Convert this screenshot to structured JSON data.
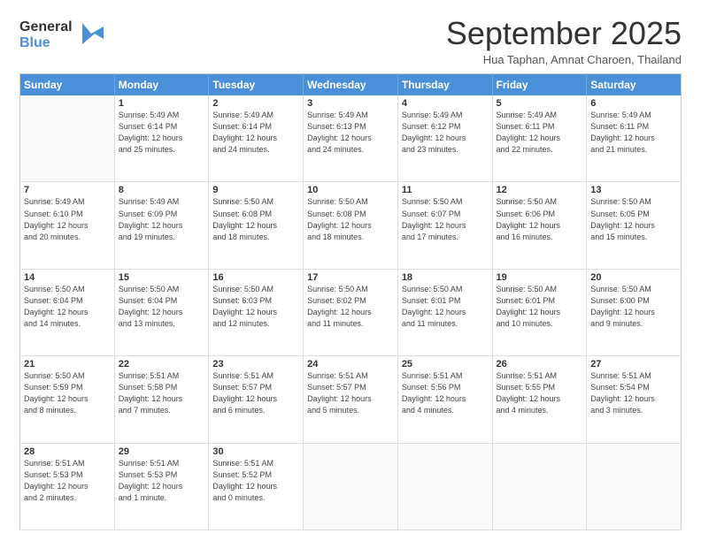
{
  "logo": {
    "line1": "General",
    "line2": "Blue"
  },
  "title": "September 2025",
  "location": "Hua Taphan, Amnat Charoen, Thailand",
  "days_of_week": [
    "Sunday",
    "Monday",
    "Tuesday",
    "Wednesday",
    "Thursday",
    "Friday",
    "Saturday"
  ],
  "weeks": [
    [
      {
        "num": "",
        "empty": true
      },
      {
        "num": "1",
        "rise": "5:49 AM",
        "set": "6:14 PM",
        "daylight": "12 hours and 25 minutes."
      },
      {
        "num": "2",
        "rise": "5:49 AM",
        "set": "6:14 PM",
        "daylight": "12 hours and 24 minutes."
      },
      {
        "num": "3",
        "rise": "5:49 AM",
        "set": "6:13 PM",
        "daylight": "12 hours and 24 minutes."
      },
      {
        "num": "4",
        "rise": "5:49 AM",
        "set": "6:12 PM",
        "daylight": "12 hours and 23 minutes."
      },
      {
        "num": "5",
        "rise": "5:49 AM",
        "set": "6:11 PM",
        "daylight": "12 hours and 22 minutes."
      },
      {
        "num": "6",
        "rise": "5:49 AM",
        "set": "6:11 PM",
        "daylight": "12 hours and 21 minutes."
      }
    ],
    [
      {
        "num": "7",
        "rise": "5:49 AM",
        "set": "6:10 PM",
        "daylight": "12 hours and 20 minutes."
      },
      {
        "num": "8",
        "rise": "5:49 AM",
        "set": "6:09 PM",
        "daylight": "12 hours and 19 minutes."
      },
      {
        "num": "9",
        "rise": "5:50 AM",
        "set": "6:08 PM",
        "daylight": "12 hours and 18 minutes."
      },
      {
        "num": "10",
        "rise": "5:50 AM",
        "set": "6:08 PM",
        "daylight": "12 hours and 18 minutes."
      },
      {
        "num": "11",
        "rise": "5:50 AM",
        "set": "6:07 PM",
        "daylight": "12 hours and 17 minutes."
      },
      {
        "num": "12",
        "rise": "5:50 AM",
        "set": "6:06 PM",
        "daylight": "12 hours and 16 minutes."
      },
      {
        "num": "13",
        "rise": "5:50 AM",
        "set": "6:05 PM",
        "daylight": "12 hours and 15 minutes."
      }
    ],
    [
      {
        "num": "14",
        "rise": "5:50 AM",
        "set": "6:04 PM",
        "daylight": "12 hours and 14 minutes."
      },
      {
        "num": "15",
        "rise": "5:50 AM",
        "set": "6:04 PM",
        "daylight": "12 hours and 13 minutes."
      },
      {
        "num": "16",
        "rise": "5:50 AM",
        "set": "6:03 PM",
        "daylight": "12 hours and 12 minutes."
      },
      {
        "num": "17",
        "rise": "5:50 AM",
        "set": "6:02 PM",
        "daylight": "12 hours and 11 minutes."
      },
      {
        "num": "18",
        "rise": "5:50 AM",
        "set": "6:01 PM",
        "daylight": "12 hours and 11 minutes."
      },
      {
        "num": "19",
        "rise": "5:50 AM",
        "set": "6:01 PM",
        "daylight": "12 hours and 10 minutes."
      },
      {
        "num": "20",
        "rise": "5:50 AM",
        "set": "6:00 PM",
        "daylight": "12 hours and 9 minutes."
      }
    ],
    [
      {
        "num": "21",
        "rise": "5:50 AM",
        "set": "5:59 PM",
        "daylight": "12 hours and 8 minutes."
      },
      {
        "num": "22",
        "rise": "5:51 AM",
        "set": "5:58 PM",
        "daylight": "12 hours and 7 minutes."
      },
      {
        "num": "23",
        "rise": "5:51 AM",
        "set": "5:57 PM",
        "daylight": "12 hours and 6 minutes."
      },
      {
        "num": "24",
        "rise": "5:51 AM",
        "set": "5:57 PM",
        "daylight": "12 hours and 5 minutes."
      },
      {
        "num": "25",
        "rise": "5:51 AM",
        "set": "5:56 PM",
        "daylight": "12 hours and 4 minutes."
      },
      {
        "num": "26",
        "rise": "5:51 AM",
        "set": "5:55 PM",
        "daylight": "12 hours and 4 minutes."
      },
      {
        "num": "27",
        "rise": "5:51 AM",
        "set": "5:54 PM",
        "daylight": "12 hours and 3 minutes."
      }
    ],
    [
      {
        "num": "28",
        "rise": "5:51 AM",
        "set": "5:53 PM",
        "daylight": "12 hours and 2 minutes."
      },
      {
        "num": "29",
        "rise": "5:51 AM",
        "set": "5:53 PM",
        "daylight": "12 hours and 1 minute."
      },
      {
        "num": "30",
        "rise": "5:51 AM",
        "set": "5:52 PM",
        "daylight": "12 hours and 0 minutes."
      },
      {
        "num": "",
        "empty": true
      },
      {
        "num": "",
        "empty": true
      },
      {
        "num": "",
        "empty": true
      },
      {
        "num": "",
        "empty": true
      }
    ]
  ]
}
